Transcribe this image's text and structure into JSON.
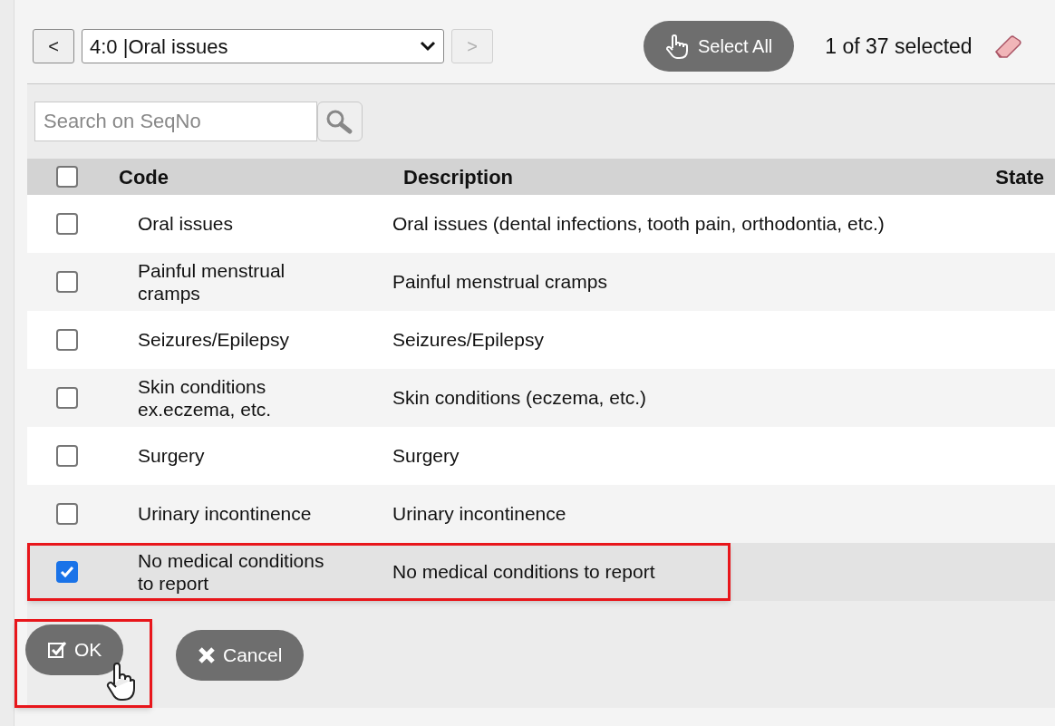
{
  "navigator": {
    "prev_label": "<",
    "selected_option": "4:0 |Oral issues",
    "next_label": ">",
    "next_disabled": true
  },
  "select_all_label": "Select All",
  "selection_count": "1 of 37 selected",
  "search": {
    "placeholder": "Search on SeqNo"
  },
  "table": {
    "header_checked": false,
    "columns": [
      "Code",
      "Description",
      "State"
    ],
    "rows": [
      {
        "code": "Oral issues",
        "description": "Oral issues (dental infections, tooth pain, orthodontia, etc.)",
        "checked": false,
        "highlighted": false
      },
      {
        "code": "Painful menstrual cramps",
        "description": "Painful menstrual cramps",
        "checked": false,
        "highlighted": false
      },
      {
        "code": "Seizures/Epilepsy",
        "description": "Seizures/Epilepsy",
        "checked": false,
        "highlighted": false
      },
      {
        "code": "Skin conditions ex.eczema, etc.",
        "description": "Skin conditions (eczema, etc.)",
        "checked": false,
        "highlighted": false
      },
      {
        "code": "Surgery",
        "description": "Surgery",
        "checked": false,
        "highlighted": false
      },
      {
        "code": "Urinary incontinence",
        "description": "Urinary incontinence",
        "checked": false,
        "highlighted": false
      },
      {
        "code": "No medical conditions to report",
        "description": "No medical conditions to report",
        "checked": true,
        "highlighted": true
      }
    ]
  },
  "buttons": [
    {
      "kind": "ok",
      "label": "OK",
      "highlighted": true
    },
    {
      "kind": "cancel",
      "label": "Cancel",
      "highlighted": false
    }
  ]
}
